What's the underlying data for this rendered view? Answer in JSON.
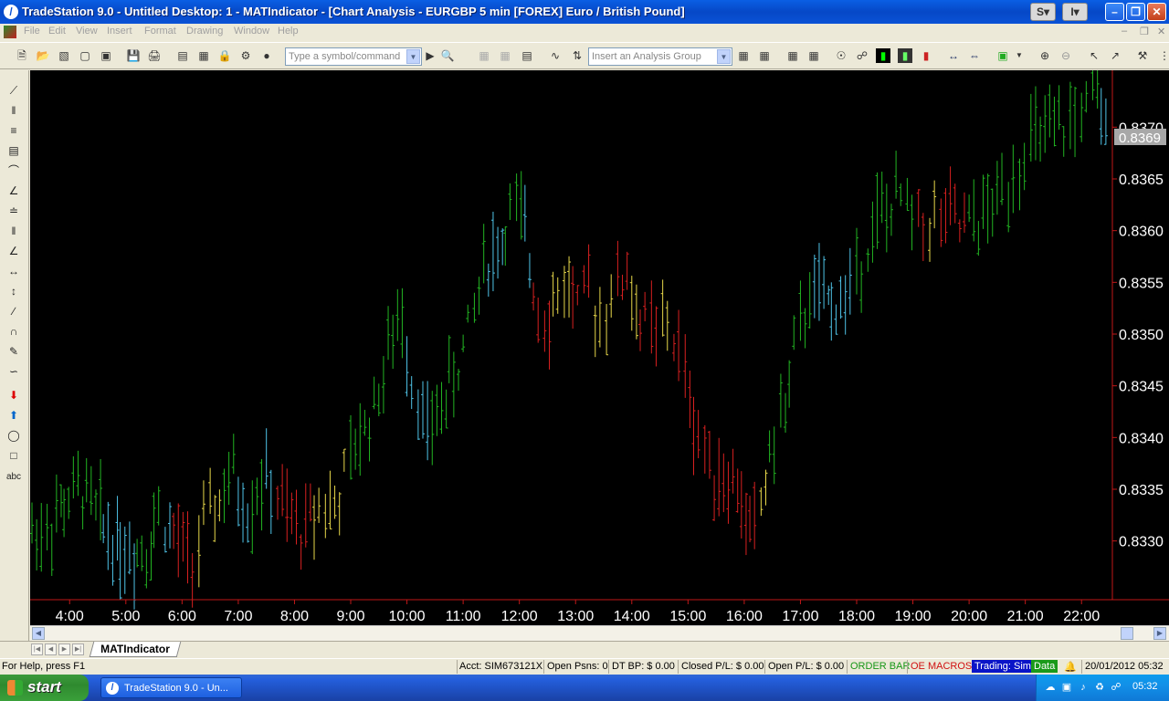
{
  "window": {
    "title": "TradeStation 9.0 - Untitled Desktop: 1 - MATIndicator - [Chart Analysis - EURGBP 5 min [FOREX] Euro / British Pound]",
    "controls": [
      "S",
      "I"
    ]
  },
  "menu": {
    "items": [
      "File",
      "Edit",
      "View",
      "Insert",
      "Format",
      "Drawing",
      "Window",
      "Help"
    ]
  },
  "toolbar": {
    "symbol_placeholder": "Type a symbol/command",
    "analysis_placeholder": "Insert an Analysis Group"
  },
  "lefttools": {
    "text_tool": "abc"
  },
  "chart_data": {
    "type": "bar",
    "symbol": "EURGBP 5 min",
    "x_labels": [
      "4:00",
      "5:00",
      "6:00",
      "7:00",
      "8:00",
      "9:00",
      "10:00",
      "11:00",
      "12:00",
      "13:00",
      "14:00",
      "15:00",
      "16:00",
      "17:00",
      "18:00",
      "19:00",
      "20:00",
      "21:00",
      "22:00"
    ],
    "y_ticks": [
      "0.8370",
      "0.8365",
      "0.8360",
      "0.8355",
      "0.8350",
      "0.8345",
      "0.8340",
      "0.8335",
      "0.8330"
    ],
    "ylim": [
      0.83245,
      0.83755
    ],
    "xlim": [
      3.33,
      22.5
    ],
    "last_price": "0.8369",
    "colors": {
      "green": "#22b422",
      "cyan": "#4fc4e8",
      "yellow": "#e8d84a",
      "red": "#d82020"
    },
    "bar_interval_hours": 0.0833,
    "series": [
      {
        "start": 3.33,
        "close": 0.8331,
        "color": "green"
      },
      {
        "start": 3.6,
        "close": 0.8333,
        "color": "green"
      },
      {
        "start": 3.9,
        "close": 0.8335,
        "color": "green"
      },
      {
        "start": 4.3,
        "close": 0.8332,
        "color": "green"
      },
      {
        "start": 4.6,
        "close": 0.833,
        "color": "cyan"
      },
      {
        "start": 4.9,
        "close": 0.8329,
        "color": "cyan"
      },
      {
        "start": 5.2,
        "close": 0.833,
        "color": "green"
      },
      {
        "start": 5.5,
        "close": 0.8333,
        "color": "green"
      },
      {
        "start": 5.7,
        "close": 0.8331,
        "color": "cyan"
      },
      {
        "start": 5.85,
        "close": 0.8329,
        "color": "red"
      },
      {
        "start": 6.1,
        "close": 0.8328,
        "color": "red"
      },
      {
        "start": 6.3,
        "close": 0.8331,
        "color": "yellow"
      },
      {
        "start": 6.5,
        "close": 0.8334,
        "color": "yellow"
      },
      {
        "start": 6.75,
        "close": 0.8336,
        "color": "green"
      },
      {
        "start": 7.0,
        "close": 0.8333,
        "color": "cyan"
      },
      {
        "start": 7.25,
        "close": 0.8336,
        "color": "green"
      },
      {
        "start": 7.5,
        "close": 0.8335,
        "color": "cyan"
      },
      {
        "start": 7.7,
        "close": 0.8332,
        "color": "red"
      },
      {
        "start": 7.95,
        "close": 0.8331,
        "color": "red"
      },
      {
        "start": 8.2,
        "close": 0.8332,
        "color": "red"
      },
      {
        "start": 8.35,
        "close": 0.8334,
        "color": "yellow"
      },
      {
        "start": 8.55,
        "close": 0.8333,
        "color": "yellow"
      },
      {
        "start": 8.8,
        "close": 0.8336,
        "color": "yellow"
      },
      {
        "start": 9.0,
        "close": 0.834,
        "color": "green"
      },
      {
        "start": 9.25,
        "close": 0.8343,
        "color": "green"
      },
      {
        "start": 9.5,
        "close": 0.8348,
        "color": "green"
      },
      {
        "start": 9.75,
        "close": 0.8352,
        "color": "green"
      },
      {
        "start": 10.0,
        "close": 0.8346,
        "color": "cyan"
      },
      {
        "start": 10.2,
        "close": 0.834,
        "color": "cyan"
      },
      {
        "start": 10.45,
        "close": 0.8344,
        "color": "green"
      },
      {
        "start": 10.75,
        "close": 0.8347,
        "color": "green"
      },
      {
        "start": 11.0,
        "close": 0.835,
        "color": "green"
      },
      {
        "start": 11.2,
        "close": 0.8357,
        "color": "green"
      },
      {
        "start": 11.45,
        "close": 0.8359,
        "color": "cyan"
      },
      {
        "start": 11.75,
        "close": 0.8362,
        "color": "green"
      },
      {
        "start": 11.95,
        "close": 0.8361,
        "color": "green"
      },
      {
        "start": 12.1,
        "close": 0.8357,
        "color": "cyan"
      },
      {
        "start": 12.25,
        "close": 0.8353,
        "color": "red"
      },
      {
        "start": 12.45,
        "close": 0.8352,
        "color": "red"
      },
      {
        "start": 12.6,
        "close": 0.8354,
        "color": "yellow"
      },
      {
        "start": 12.8,
        "close": 0.8355,
        "color": "yellow"
      },
      {
        "start": 12.95,
        "close": 0.8352,
        "color": "red"
      },
      {
        "start": 13.15,
        "close": 0.8354,
        "color": "red"
      },
      {
        "start": 13.35,
        "close": 0.8352,
        "color": "yellow"
      },
      {
        "start": 13.55,
        "close": 0.8354,
        "color": "yellow"
      },
      {
        "start": 13.75,
        "close": 0.8356,
        "color": "red"
      },
      {
        "start": 14.0,
        "close": 0.8352,
        "color": "yellow"
      },
      {
        "start": 14.15,
        "close": 0.8351,
        "color": "red"
      },
      {
        "start": 14.35,
        "close": 0.835,
        "color": "red"
      },
      {
        "start": 14.55,
        "close": 0.8351,
        "color": "yellow"
      },
      {
        "start": 14.75,
        "close": 0.8348,
        "color": "red"
      },
      {
        "start": 14.95,
        "close": 0.8344,
        "color": "red"
      },
      {
        "start": 15.1,
        "close": 0.834,
        "color": "red"
      },
      {
        "start": 15.3,
        "close": 0.8337,
        "color": "red"
      },
      {
        "start": 15.55,
        "close": 0.8336,
        "color": "red"
      },
      {
        "start": 15.8,
        "close": 0.8335,
        "color": "red"
      },
      {
        "start": 15.95,
        "close": 0.8332,
        "color": "red"
      },
      {
        "start": 16.1,
        "close": 0.8331,
        "color": "red"
      },
      {
        "start": 16.3,
        "close": 0.8336,
        "color": "yellow"
      },
      {
        "start": 16.45,
        "close": 0.834,
        "color": "green"
      },
      {
        "start": 16.65,
        "close": 0.8343,
        "color": "green"
      },
      {
        "start": 16.8,
        "close": 0.8348,
        "color": "green"
      },
      {
        "start": 17.0,
        "close": 0.8354,
        "color": "green"
      },
      {
        "start": 17.25,
        "close": 0.8353,
        "color": "cyan"
      },
      {
        "start": 17.55,
        "close": 0.8353,
        "color": "cyan"
      },
      {
        "start": 17.8,
        "close": 0.8354,
        "color": "cyan"
      },
      {
        "start": 18.0,
        "close": 0.8358,
        "color": "green"
      },
      {
        "start": 18.2,
        "close": 0.8361,
        "color": "green"
      },
      {
        "start": 18.45,
        "close": 0.8362,
        "color": "green"
      },
      {
        "start": 18.7,
        "close": 0.8363,
        "color": "green"
      },
      {
        "start": 18.9,
        "close": 0.8361,
        "color": "green"
      },
      {
        "start": 19.1,
        "close": 0.8361,
        "color": "red"
      },
      {
        "start": 19.3,
        "close": 0.8361,
        "color": "yellow"
      },
      {
        "start": 19.5,
        "close": 0.8361,
        "color": "red"
      },
      {
        "start": 19.75,
        "close": 0.836,
        "color": "red"
      },
      {
        "start": 20.0,
        "close": 0.8361,
        "color": "green"
      },
      {
        "start": 20.25,
        "close": 0.8362,
        "color": "green"
      },
      {
        "start": 20.5,
        "close": 0.8364,
        "color": "green"
      },
      {
        "start": 20.7,
        "close": 0.8366,
        "color": "green"
      },
      {
        "start": 20.9,
        "close": 0.8368,
        "color": "green"
      },
      {
        "start": 21.1,
        "close": 0.8369,
        "color": "green"
      },
      {
        "start": 21.35,
        "close": 0.8369,
        "color": "green"
      },
      {
        "start": 21.6,
        "close": 0.837,
        "color": "green"
      },
      {
        "start": 21.8,
        "close": 0.8371,
        "color": "green"
      },
      {
        "start": 22.0,
        "close": 0.8372,
        "color": "green"
      },
      {
        "start": 22.2,
        "close": 0.8372,
        "color": "green"
      },
      {
        "start": 22.35,
        "close": 0.8369,
        "color": "cyan"
      }
    ]
  },
  "tabs": {
    "active": "MATIndicator"
  },
  "status": {
    "help": "For Help, press F1",
    "acct": "Acct: SIM673121X",
    "open_psns": "Open Psns: 0",
    "dt_bp": "DT BP: $ 0.00",
    "closed_pl": "Closed P/L: $ 0.00",
    "open_pl": "Open P/L: $ 0.00",
    "order_bar": "ORDER BAR",
    "oe_macros": "OE MACROS",
    "trading": "Trading: Sim",
    "data": "Data",
    "datetime": "20/01/2012 05:32"
  },
  "taskbar": {
    "start": "start",
    "item": "TradeStation 9.0 - Un...",
    "clock": "05:32"
  }
}
